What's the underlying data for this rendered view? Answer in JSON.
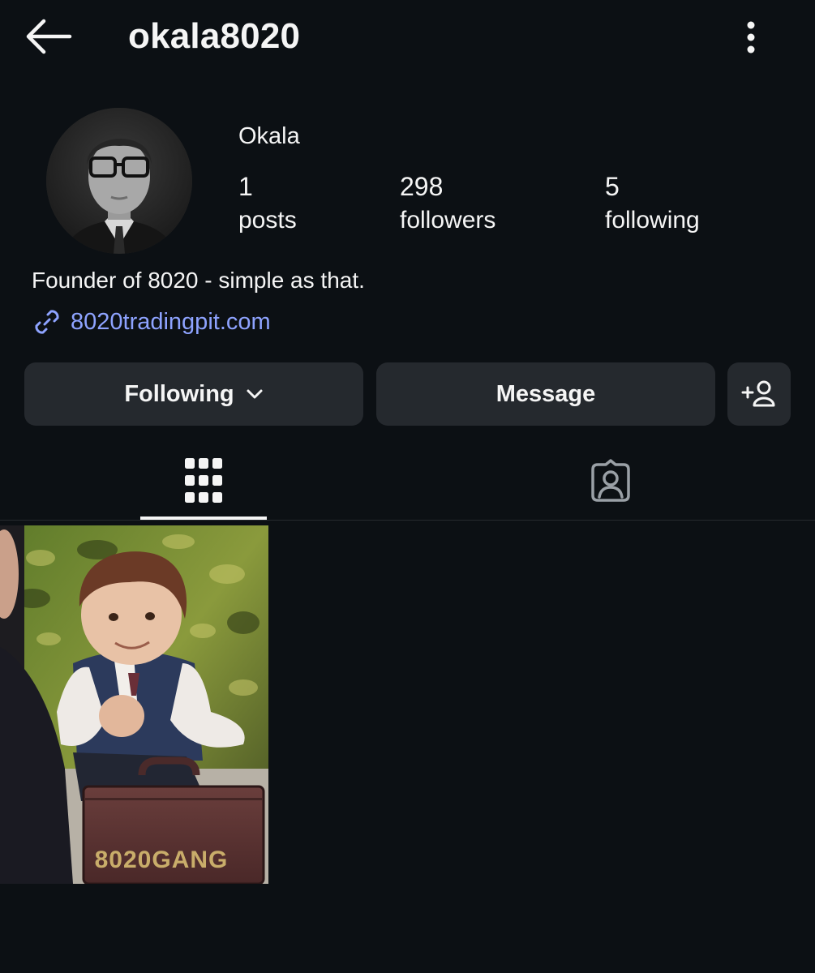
{
  "header": {
    "username": "okala8020",
    "back_icon": "arrow-left-icon",
    "more_icon": "more-vertical-icon"
  },
  "profile": {
    "display_name": "Okala",
    "stats": {
      "posts": {
        "value": "1",
        "label": "posts"
      },
      "followers": {
        "value": "298",
        "label": "followers"
      },
      "following": {
        "value": "5",
        "label": "following"
      }
    },
    "bio": "Founder of 8020 - simple as that.",
    "link": "8020tradingpit.com"
  },
  "actions": {
    "following_label": "Following",
    "message_label": "Message"
  },
  "tabs": [
    {
      "name": "posts-grid",
      "icon": "grid-icon",
      "active": true
    },
    {
      "name": "tagged",
      "icon": "tagged-person-icon",
      "active": false
    }
  ],
  "posts": [
    {
      "caption_on_image": "8020GANG"
    }
  ],
  "colors": {
    "background": "#0c1014",
    "button": "#25292e",
    "link": "#8ea3ff",
    "text": "#f5f5f5"
  }
}
